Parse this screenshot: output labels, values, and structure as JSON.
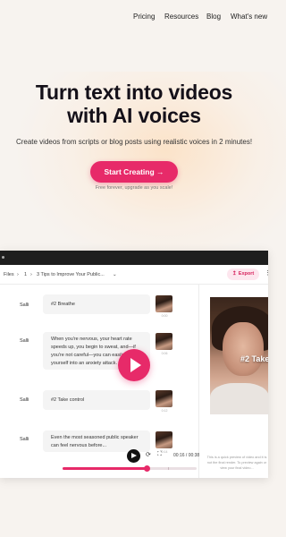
{
  "nav": {
    "items": [
      "Pricing",
      "Resources",
      "Blog",
      "What's new"
    ]
  },
  "hero": {
    "title_line1": "Turn text into videos",
    "title_line2": "with AI voices",
    "subtitle": "Create videos from scripts or blog posts using realistic voices in 2 minutes!",
    "cta_label": "Start Creating →",
    "cta_note": "Free forever, upgrade as you scale!"
  },
  "editor": {
    "breadcrumb": [
      "Files",
      "›",
      "1",
      "›",
      "3 Tips to Improve Your Public..."
    ],
    "breadcrumb_dropdown": "⌄",
    "export_label": "Export",
    "export_icon": "↥",
    "more_icon": "⋮",
    "rows": [
      {
        "speaker": "Salli",
        "text": "#2 Breathe",
        "thumb_label": "0:00"
      },
      {
        "speaker": "Salli",
        "text": "When you're nervous, your heart rate speeds up, you begin to sweat, and—if you're not careful—you can easily work yourself into an anxiety attack.",
        "thumb_label": "0:06"
      },
      {
        "speaker": "Salli",
        "text": "#2 Take control",
        "thumb_label": "0:12"
      },
      {
        "speaker": "Salli",
        "text": "Even the most seasoned public speaker can feel nervous before...",
        "thumb_label": "0:14"
      }
    ],
    "preview_overlay": "#2 Take",
    "preview_caption": "This is a quick preview of video and it is not the final render. To preview again or view your final video...",
    "time_current": "00:16",
    "time_total": "00:38",
    "progress_fraction": 0.63,
    "brand_color": "#e72a69"
  }
}
